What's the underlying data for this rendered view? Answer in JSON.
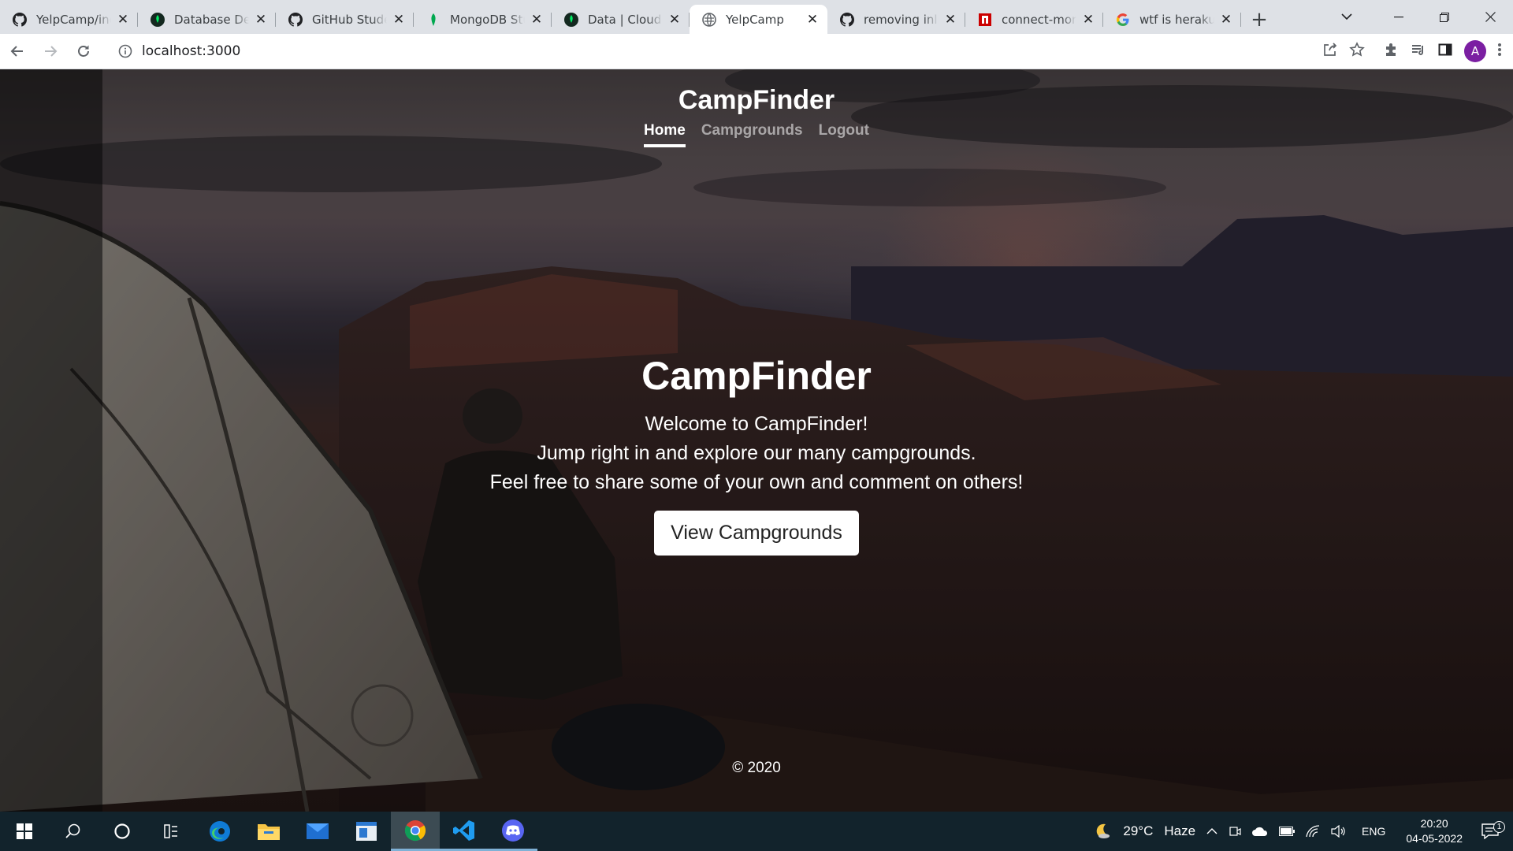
{
  "browser": {
    "tabs": [
      {
        "title": "YelpCamp/index",
        "icon": "github-icon",
        "active": false
      },
      {
        "title": "Database Deployments",
        "icon": "mongodb-leaf-icon",
        "active": false
      },
      {
        "title": "GitHub Student",
        "icon": "github-icon",
        "active": false
      },
      {
        "title": "MongoDB Student",
        "icon": "mongodb-leaf-icon",
        "active": false
      },
      {
        "title": "Data | Cloud: MongoDB",
        "icon": "mongodb-leaf-icon",
        "active": false
      },
      {
        "title": "YelpCamp",
        "icon": "globe-icon",
        "active": true
      },
      {
        "title": "removing inline",
        "icon": "github-icon",
        "active": false
      },
      {
        "title": "connect-mongo",
        "icon": "npm-icon",
        "active": false
      },
      {
        "title": "wtf is heraku",
        "icon": "google-icon",
        "active": false
      }
    ],
    "url": "localhost:3000",
    "profile_initial": "A"
  },
  "site": {
    "brand": "CampFinder",
    "nav": [
      {
        "label": "Home",
        "active": true
      },
      {
        "label": "Campgrounds",
        "active": false
      },
      {
        "label": "Logout",
        "active": false
      }
    ],
    "hero": {
      "title": "CampFinder",
      "lines": [
        "Welcome to CampFinder!",
        "Jump right in and explore our many campgrounds.",
        "Feel free to share some of your own and comment on others!"
      ],
      "button": "View Campgrounds"
    },
    "footer": "© 2020"
  },
  "taskbar": {
    "weather_temp": "29°C",
    "weather_desc": "Haze",
    "language": "ENG",
    "time": "20:20",
    "date": "04-05-2022",
    "notification_count": "1"
  }
}
